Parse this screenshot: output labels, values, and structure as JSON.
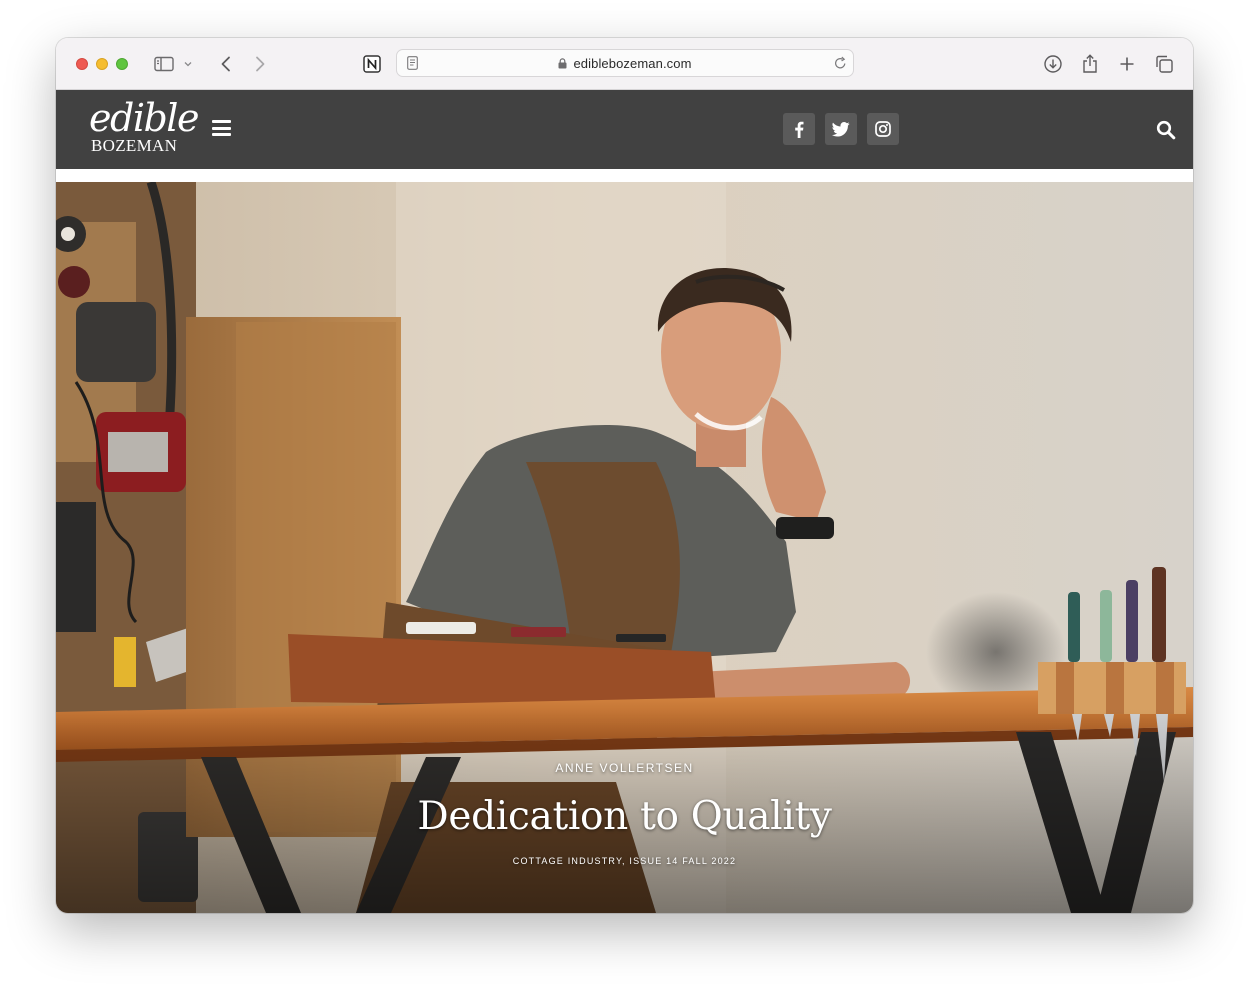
{
  "browser": {
    "url": "ediblebozeman.com"
  },
  "site": {
    "logo_top": "edible",
    "logo_bottom": "BOZEMAN",
    "social": [
      "facebook-icon",
      "twitter-icon",
      "instagram-icon"
    ]
  },
  "hero": {
    "author": "ANNE VOLLERTSEN",
    "title": "Dedication to Quality",
    "meta": "COTTAGE INDUSTRY, ISSUE 14 FALL 2022"
  },
  "colors": {
    "header_bg": "#414141",
    "social_bg": "#5a5a5a"
  }
}
